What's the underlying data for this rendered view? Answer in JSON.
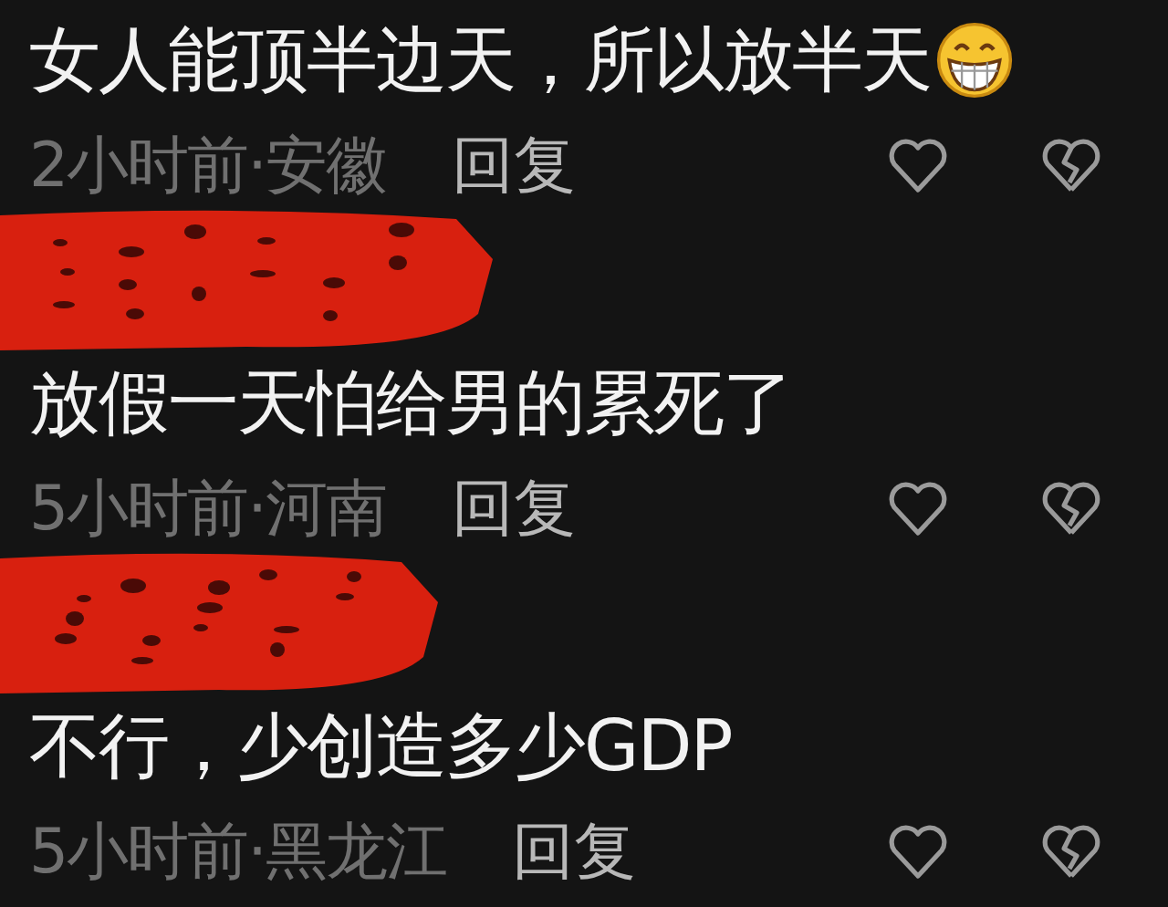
{
  "comments": [
    {
      "author_redacted": false,
      "text": "女人能顶半边天，所以放半天",
      "emoji": true,
      "time_location": "2小时前·安徽",
      "reply": "回复"
    },
    {
      "author_redacted": true,
      "text": "放假一天怕给男的累死了",
      "emoji": false,
      "time_location": "5小时前·河南",
      "reply": "回复"
    },
    {
      "author_redacted": true,
      "text": "不行，少创造多少GDP",
      "emoji": false,
      "time_location": "5小时前·黑龙江",
      "reply": "回复"
    }
  ]
}
